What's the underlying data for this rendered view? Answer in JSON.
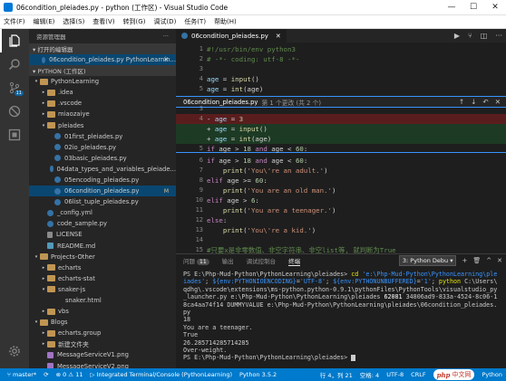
{
  "window": {
    "title": "06condition_pleiades.py - python (工作区) - Visual Studio Code",
    "minimize": "—",
    "maximize": "☐",
    "close": "✕"
  },
  "menu": [
    "文件(F)",
    "编辑(E)",
    "选择(S)",
    "查看(V)",
    "转到(G)",
    "调试(D)",
    "任务(T)",
    "帮助(H)"
  ],
  "activity": {
    "scm_badge": "11"
  },
  "sidebar": {
    "header": "资源管理器",
    "header_more": "···",
    "open_editors_title": "▾ 打开的编辑器",
    "open_editors": [
      {
        "label": "06condition_pleiades.py PythonLearnin...",
        "close": "✕"
      }
    ],
    "workspace_title": "▾ PYTHON (工作区)",
    "tree": [
      {
        "indent": 0,
        "twisty": "▾",
        "type": "folder",
        "label": "PythonLearning",
        "dot": true
      },
      {
        "indent": 1,
        "twisty": "▸",
        "type": "folder",
        "label": ".idea"
      },
      {
        "indent": 1,
        "twisty": "▸",
        "type": "folder",
        "label": ".vscode"
      },
      {
        "indent": 1,
        "twisty": "▸",
        "type": "folder",
        "label": "miaozaiye"
      },
      {
        "indent": 1,
        "twisty": "▾",
        "type": "folder",
        "label": "pleiades",
        "dot": true
      },
      {
        "indent": 2,
        "twisty": "",
        "type": "py",
        "label": "01first_pleiades.py"
      },
      {
        "indent": 2,
        "twisty": "",
        "type": "py",
        "label": "02io_pleiades.py"
      },
      {
        "indent": 2,
        "twisty": "",
        "type": "py",
        "label": "03basic_pleiades.py"
      },
      {
        "indent": 2,
        "twisty": "",
        "type": "py",
        "label": "04data_types_and_variables_pleiade..."
      },
      {
        "indent": 2,
        "twisty": "",
        "type": "py",
        "label": "05encoding_pleiades.py"
      },
      {
        "indent": 2,
        "twisty": "",
        "type": "py",
        "label": "06condition_pleiades.py",
        "selected": true,
        "flag": "M"
      },
      {
        "indent": 2,
        "twisty": "",
        "type": "py",
        "label": "06list_tuple_pleiades.py"
      },
      {
        "indent": 1,
        "twisty": "",
        "type": "py",
        "label": "_config.yml"
      },
      {
        "indent": 1,
        "twisty": "",
        "type": "py",
        "label": "code_sample.py"
      },
      {
        "indent": 1,
        "twisty": "",
        "type": "txt",
        "label": "LICENSE"
      },
      {
        "indent": 1,
        "twisty": "",
        "type": "md",
        "label": "README.md"
      },
      {
        "indent": 0,
        "twisty": "▾",
        "type": "folder",
        "label": "Projects-Other"
      },
      {
        "indent": 1,
        "twisty": "▸",
        "type": "folder",
        "label": "echarts"
      },
      {
        "indent": 1,
        "twisty": "▸",
        "type": "folder",
        "label": "echarts-stat"
      },
      {
        "indent": 1,
        "twisty": "▾",
        "type": "folder",
        "label": "snaker-js"
      },
      {
        "indent": 2,
        "twisty": "",
        "type": "html",
        "label": "snaker.html"
      },
      {
        "indent": 1,
        "twisty": "▸",
        "type": "folder",
        "label": "vbs"
      },
      {
        "indent": 0,
        "twisty": "▾",
        "type": "folder",
        "label": "Blogs"
      },
      {
        "indent": 1,
        "twisty": "▸",
        "type": "folder",
        "label": "echarts.group"
      },
      {
        "indent": 1,
        "twisty": "▸",
        "type": "folder",
        "label": "新建文件夹"
      },
      {
        "indent": 1,
        "twisty": "",
        "type": "png",
        "label": "MessageServiceV1.png"
      },
      {
        "indent": 1,
        "twisty": "",
        "type": "png",
        "label": "MessageServiceV2.png"
      }
    ]
  },
  "editor": {
    "tab_label": "06condition_pleiades.py",
    "tab_close": "✕",
    "tools": [
      "▶",
      "⑂",
      "◫",
      "···"
    ],
    "top_lines": [
      {
        "n": "1",
        "tokens": [
          [
            "cm",
            "#!/usr/bin/env python3"
          ]
        ]
      },
      {
        "n": "2",
        "tokens": [
          [
            "cm",
            "# -*- coding: utf-8 -*-"
          ]
        ]
      },
      {
        "n": "3",
        "tokens": []
      },
      {
        "n": "4",
        "tokens": [
          [
            "var",
            "age"
          ],
          [
            "pl",
            " = "
          ],
          [
            "fn",
            "input"
          ],
          [
            "pl",
            "()"
          ]
        ]
      },
      {
        "n": "5",
        "tokens": [
          [
            "var",
            "age"
          ],
          [
            "pl",
            " = "
          ],
          [
            "fn",
            "int"
          ],
          [
            "pl",
            "(age)"
          ]
        ]
      }
    ],
    "peek": {
      "file": "06condition_pleiades.py",
      "sub": "第 1 个更改 (共 2 个)",
      "tools": [
        "↑",
        "↓",
        "↶",
        "✕"
      ],
      "lines": [
        {
          "n": "3",
          "kind": "",
          "tokens": []
        },
        {
          "n": "4",
          "kind": "del",
          "tokens": [
            [
              "pl",
              "- "
            ],
            [
              "var",
              "age"
            ],
            [
              "pl",
              " = "
            ],
            [
              "num",
              "3"
            ]
          ]
        },
        {
          "n": "",
          "kind": "add",
          "tokens": [
            [
              "pl",
              "+ "
            ],
            [
              "var",
              "age"
            ],
            [
              "pl",
              " = "
            ],
            [
              "fn",
              "input"
            ],
            [
              "pl",
              "()"
            ]
          ]
        },
        {
          "n": "",
          "kind": "add",
          "tokens": [
            [
              "pl",
              "+ "
            ],
            [
              "var",
              "age"
            ],
            [
              "pl",
              " = "
            ],
            [
              "fn",
              "int"
            ],
            [
              "pl",
              "(age)"
            ]
          ]
        },
        {
          "n": "5",
          "kind": "",
          "tokens": [
            [
              "kw",
              "if"
            ],
            [
              "pl",
              " age > "
            ],
            [
              "num",
              "18"
            ],
            [
              "pl",
              " "
            ],
            [
              "kw",
              "and"
            ],
            [
              "pl",
              " age < "
            ],
            [
              "num",
              "60"
            ],
            [
              "pl",
              ":"
            ]
          ]
        }
      ]
    },
    "bottom_lines": [
      {
        "n": "6",
        "tokens": [
          [
            "kw",
            "if"
          ],
          [
            "pl",
            " age > "
          ],
          [
            "num",
            "18"
          ],
          [
            "pl",
            " "
          ],
          [
            "kw",
            "and"
          ],
          [
            "pl",
            " age < "
          ],
          [
            "num",
            "60"
          ],
          [
            "pl",
            ":"
          ]
        ]
      },
      {
        "n": "7",
        "tokens": [
          [
            "pl",
            "    "
          ],
          [
            "fn",
            "print"
          ],
          [
            "pl",
            "("
          ],
          [
            "str",
            "'You\\'re an adult.'"
          ],
          [
            "pl",
            ")"
          ]
        ]
      },
      {
        "n": "8",
        "tokens": [
          [
            "kw",
            "elif"
          ],
          [
            "pl",
            " age >= "
          ],
          [
            "num",
            "60"
          ],
          [
            "pl",
            ":"
          ]
        ]
      },
      {
        "n": "9",
        "tokens": [
          [
            "pl",
            "    "
          ],
          [
            "fn",
            "print"
          ],
          [
            "pl",
            "("
          ],
          [
            "str",
            "'You are an old man.'"
          ],
          [
            "pl",
            ")"
          ]
        ]
      },
      {
        "n": "10",
        "tokens": [
          [
            "kw",
            "elif"
          ],
          [
            "pl",
            " age > "
          ],
          [
            "num",
            "6"
          ],
          [
            "pl",
            ":"
          ]
        ]
      },
      {
        "n": "11",
        "tokens": [
          [
            "pl",
            "    "
          ],
          [
            "fn",
            "print"
          ],
          [
            "pl",
            "("
          ],
          [
            "str",
            "'You are a teenager.'"
          ],
          [
            "pl",
            ")"
          ]
        ]
      },
      {
        "n": "12",
        "tokens": [
          [
            "kw",
            "else"
          ],
          [
            "pl",
            ":"
          ]
        ]
      },
      {
        "n": "13",
        "tokens": [
          [
            "pl",
            "    "
          ],
          [
            "fn",
            "print"
          ],
          [
            "pl",
            "("
          ],
          [
            "str",
            "'You\\'re a kid.'"
          ],
          [
            "pl",
            ")"
          ]
        ]
      },
      {
        "n": "14",
        "tokens": []
      },
      {
        "n": "15",
        "tokens": [
          [
            "cm",
            "#只要x是非零数值、非空字符串、非空list等, 就判断为True"
          ]
        ]
      }
    ]
  },
  "panel": {
    "tabs": [
      {
        "label": "问题",
        "badge": "11"
      },
      {
        "label": "输出"
      },
      {
        "label": "调试控制台"
      },
      {
        "label": "终端",
        "active": true
      }
    ],
    "terminal_select": "3: Python Debu ▾",
    "controls": [
      "+",
      "🗑",
      "^",
      "✕"
    ],
    "terminal": [
      [
        [
          "w",
          "PS E:\\Php-Mud-Python\\PythonLearning\\pleiades> "
        ],
        [
          "y",
          "cd "
        ],
        [
          "c",
          "'e:\\Php-Mud-Python\\PythonLearning\\ple"
        ]
      ],
      [
        [
          "c",
          "iades'"
        ],
        [
          "w",
          "; "
        ],
        [
          "c",
          "${env:PYTHONIOENCODING}"
        ],
        [
          "w",
          "="
        ],
        [
          "c",
          "'UTF-8'"
        ],
        [
          "w",
          "; "
        ],
        [
          "c",
          "${env:PYTHONUNBUFFERED}"
        ],
        [
          "w",
          "="
        ],
        [
          "c",
          "'1'"
        ],
        [
          "w",
          "; "
        ],
        [
          "y",
          "python"
        ],
        [
          "w",
          " C:\\Users\\"
        ]
      ],
      [
        [
          "w",
          "qdhg\\.vscode\\extensions\\ms-python.python-0.9.1\\pythonFiles\\PythonTools\\visualstudio_py"
        ]
      ],
      [
        [
          "w",
          "_launcher.py e:\\Php-Mud-Python\\PythonLearning\\pleiades "
        ],
        [
          "t",
          "62081"
        ],
        [
          "w",
          " 34806ad9-833a-4524-8c06-1"
        ]
      ],
      [
        [
          "w",
          "8ca4aa74f14 DUMMYVALUE e:\\Php-Mud-Python\\PythonLearning\\pleiades\\06condition_pleiades."
        ]
      ],
      [
        [
          "w",
          "py"
        ]
      ],
      [
        [
          "w",
          "18"
        ]
      ],
      [
        [
          "w",
          "You are a teenager."
        ]
      ],
      [
        [
          "w",
          "True"
        ]
      ],
      [
        [
          "w",
          "26.285714285714285"
        ]
      ],
      [
        [
          "w",
          "Over-weight."
        ]
      ],
      [
        [
          "w",
          "PS E:\\Php-Mud-Python\\PythonLearning\\pleiades> "
        ]
      ]
    ]
  },
  "status": {
    "branch": "⑂ master*",
    "sync": "⟳",
    "problems": "⊗ 0 ⚠ 11",
    "terminal": "▷ Integrated Terminal/Console (PythonLearning)",
    "python": "Python 3.5.2",
    "position": "行 4，列 21",
    "spaces": "空格: 4",
    "encoding": "UTF-8",
    "eol": "CRLF",
    "language": "Python",
    "watermark_php": "php",
    "watermark_cn": "中文网"
  }
}
